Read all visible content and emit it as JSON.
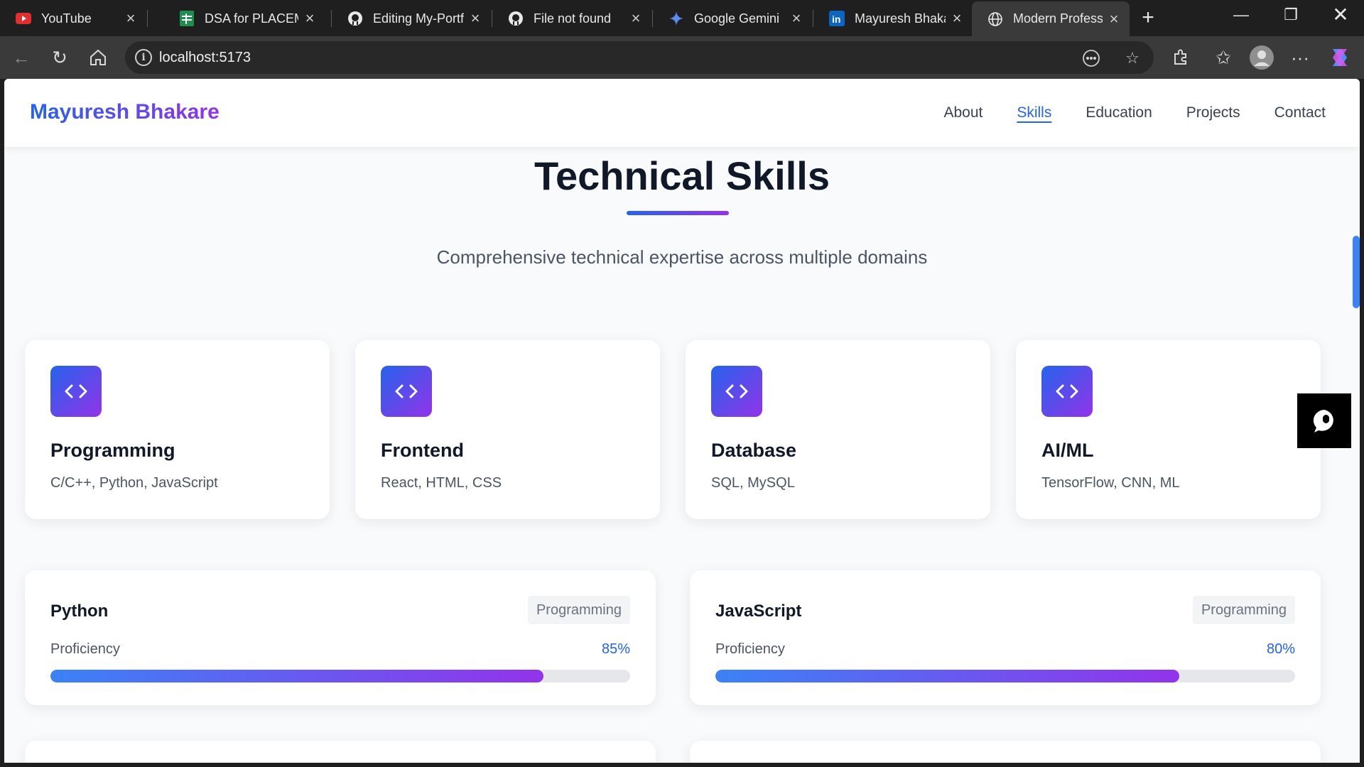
{
  "browser": {
    "tabs": [
      {
        "label": "YouTube",
        "icon": "youtube-icon",
        "active": false
      },
      {
        "label": "DSA for PLACEMENT",
        "icon": "sheets-icon",
        "active": false
      },
      {
        "label": "Editing My-Portfolio",
        "icon": "github-icon",
        "active": false
      },
      {
        "label": "File not found",
        "icon": "github-icon",
        "active": false
      },
      {
        "label": "Google Gemini",
        "icon": "gemini-icon",
        "active": false
      },
      {
        "label": "Mayuresh Bhakare",
        "icon": "linkedin-icon",
        "active": false
      },
      {
        "label": "Modern Professional",
        "icon": "globe-icon",
        "active": true
      }
    ],
    "url": "localhost:5173"
  },
  "navbar": {
    "brand": "Mayuresh Bhakare",
    "links": [
      {
        "label": "About",
        "active": false
      },
      {
        "label": "Skills",
        "active": true
      },
      {
        "label": "Education",
        "active": false
      },
      {
        "label": "Projects",
        "active": false
      },
      {
        "label": "Contact",
        "active": false
      }
    ]
  },
  "section": {
    "title": "Technical Skills",
    "subtitle": "Comprehensive technical expertise across multiple domains"
  },
  "categories": [
    {
      "title": "Programming",
      "desc": "C/C++, Python, JavaScript",
      "icon": "code-icon"
    },
    {
      "title": "Frontend",
      "desc": "React, HTML, CSS",
      "icon": "code-icon"
    },
    {
      "title": "Database",
      "desc": "SQL, MySQL",
      "icon": "code-icon"
    },
    {
      "title": "AI/ML",
      "desc": "TensorFlow, CNN, ML",
      "icon": "code-icon"
    }
  ],
  "skills": [
    {
      "name": "Python",
      "category": "Programming",
      "proficiency_label": "Proficiency",
      "percent_text": "85%",
      "percent": 85
    },
    {
      "name": "JavaScript",
      "category": "Programming",
      "proficiency_label": "Proficiency",
      "percent_text": "80%",
      "percent": 80
    }
  ],
  "colors": {
    "accent_blue": "#2563eb",
    "accent_purple": "#9333ea"
  }
}
